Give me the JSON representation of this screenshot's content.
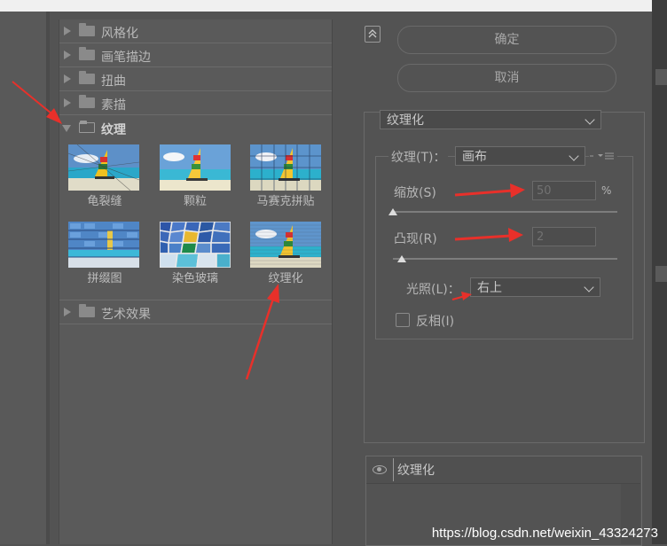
{
  "filter_tree": {
    "folders_top": [
      {
        "label": "风格化"
      },
      {
        "label": "画笔描边"
      },
      {
        "label": "扭曲"
      },
      {
        "label": "素描"
      }
    ],
    "open_folder": {
      "label": "纹理"
    },
    "thumbnails": [
      {
        "label": "龟裂缝",
        "icon": "craquelure-thumbnail"
      },
      {
        "label": "颗粒",
        "icon": "grain-thumbnail"
      },
      {
        "label": "马赛克拼贴",
        "icon": "mosaic-tiles-thumbnail"
      },
      {
        "label": "拼缀图",
        "icon": "patchwork-thumbnail"
      },
      {
        "label": "染色玻璃",
        "icon": "stained-glass-thumbnail"
      },
      {
        "label": "纹理化",
        "icon": "texturizer-thumbnail"
      }
    ],
    "folders_bottom": [
      {
        "label": "艺术效果"
      }
    ]
  },
  "buttons": {
    "ok": "确定",
    "cancel": "取消"
  },
  "filter_select": {
    "value": "纹理化"
  },
  "texture": {
    "label": "纹理(T)：",
    "value": "画布",
    "menu_icon": "panel-menu-icon"
  },
  "scaling": {
    "label": "缩放(S)",
    "value": "50",
    "unit": "%",
    "level": 0.0
  },
  "relief": {
    "label": "凸现(R)",
    "value": "2",
    "level": 0.04
  },
  "light": {
    "label": "光照(L)：",
    "value": "右上"
  },
  "invert": {
    "label": "反相(I)",
    "checked": false
  },
  "layer": {
    "name": "纹理化",
    "icon": "eye-icon"
  },
  "watermark": "https://blog.csdn.net/weixin_43324273",
  "colors": {
    "annotation": "#e8302a",
    "panel_bg": "#535353"
  }
}
